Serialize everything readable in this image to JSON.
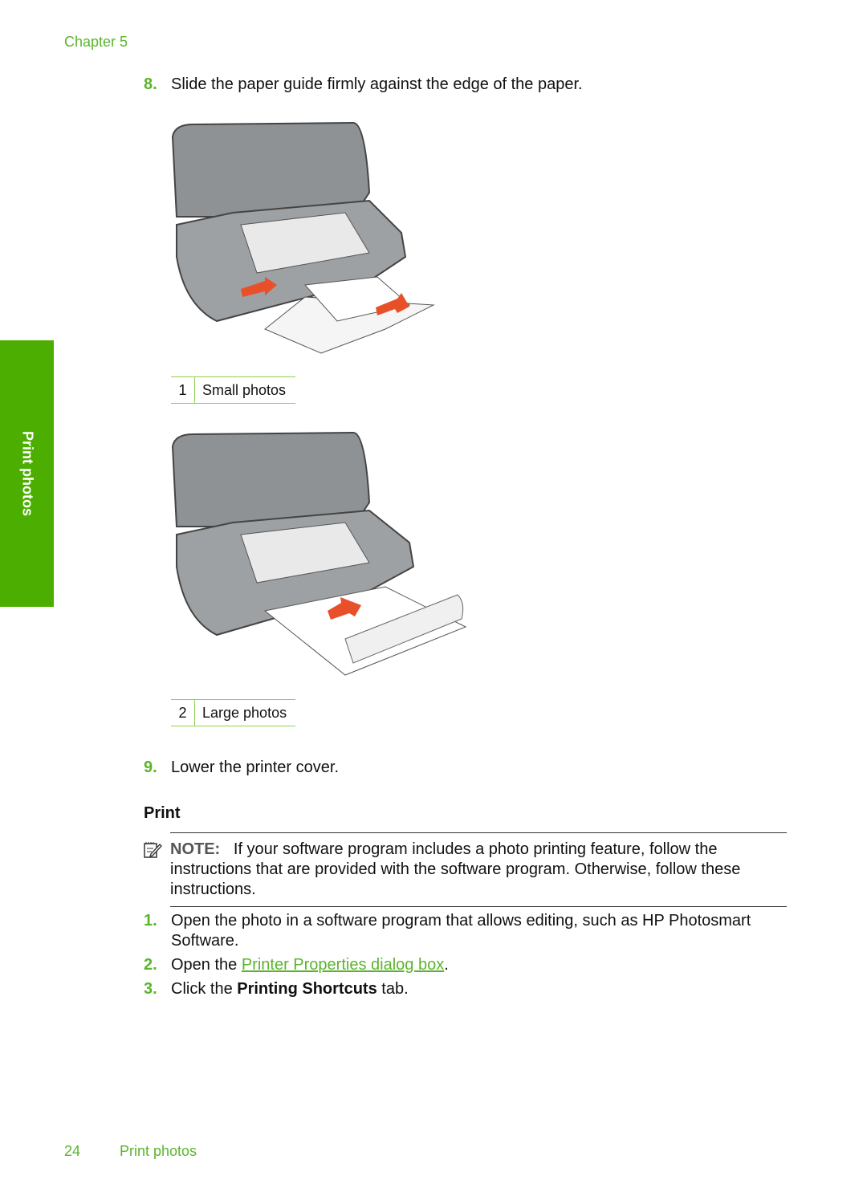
{
  "header": {
    "chapter": "Chapter 5"
  },
  "side_tab": {
    "label": "Print photos"
  },
  "steps_top": [
    {
      "number": "8.",
      "text": "Slide the paper guide firmly against the edge of the paper."
    },
    {
      "number": "9.",
      "text": "Lower the printer cover."
    }
  ],
  "figures": [
    {
      "number": "1",
      "label": "Small photos"
    },
    {
      "number": "2",
      "label": "Large photos"
    }
  ],
  "section": {
    "heading": "Print"
  },
  "note": {
    "label": "NOTE:",
    "text": "If your software program includes a photo printing feature, follow the instructions that are provided with the software program. Otherwise, follow these instructions."
  },
  "steps_bottom": [
    {
      "number": "1.",
      "line1": "Open the photo in a software program that allows editing, such as HP Photosmart",
      "line2": "Software."
    },
    {
      "number": "2.",
      "prefix": "Open the ",
      "link": "Printer Properties dialog box",
      "suffix": "."
    },
    {
      "number": "3.",
      "prefix": "Click the ",
      "bold": "Printing Shortcuts",
      "suffix": " tab."
    }
  ],
  "footer": {
    "page": "24",
    "section": "Print photos"
  },
  "colors": {
    "accent": "#5bb42c",
    "side_tab": "#4cae00"
  }
}
